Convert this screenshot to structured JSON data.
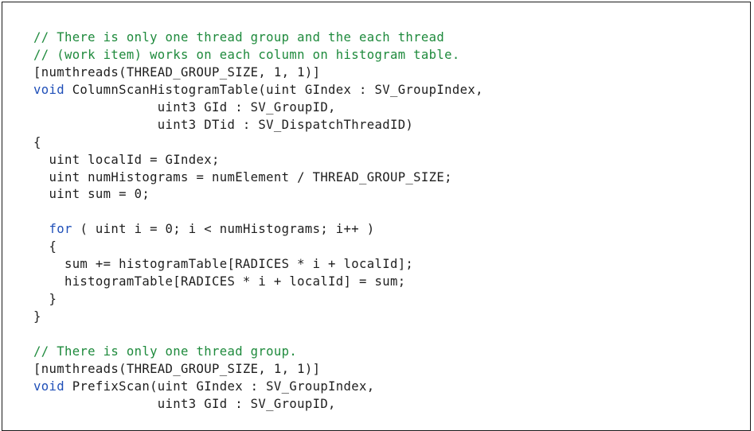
{
  "code": {
    "lines": [
      [
        {
          "t": "// There is only one thread group and the each thread",
          "k": "comment"
        }
      ],
      [
        {
          "t": "// (work item) works on each column on histogram table.",
          "k": "comment"
        }
      ],
      [
        {
          "t": "[numthreads(THREAD_GROUP_SIZE, 1, 1)]",
          "k": "plain"
        }
      ],
      [
        {
          "t": "void",
          "k": "keyword"
        },
        {
          "t": " ColumnScanHistogramTable(uint GIndex : SV_GroupIndex,",
          "k": "plain"
        }
      ],
      [
        {
          "t": "                uint3 GId : SV_GroupID,",
          "k": "plain"
        }
      ],
      [
        {
          "t": "                uint3 DTid : SV_DispatchThreadID)",
          "k": "plain"
        }
      ],
      [
        {
          "t": "{",
          "k": "plain"
        }
      ],
      [
        {
          "t": "  uint localId = GIndex;",
          "k": "plain"
        }
      ],
      [
        {
          "t": "  uint numHistograms = numElement / THREAD_GROUP_SIZE;",
          "k": "plain"
        }
      ],
      [
        {
          "t": "  uint sum = 0;",
          "k": "plain"
        }
      ],
      [
        {
          "t": "",
          "k": "plain"
        }
      ],
      [
        {
          "t": "  ",
          "k": "plain"
        },
        {
          "t": "for",
          "k": "keyword"
        },
        {
          "t": " ( uint i = 0; i < numHistograms; i++ )",
          "k": "plain"
        }
      ],
      [
        {
          "t": "  {",
          "k": "plain"
        }
      ],
      [
        {
          "t": "    sum += histogramTable[RADICES * i + localId];",
          "k": "plain"
        }
      ],
      [
        {
          "t": "    histogramTable[RADICES * i + localId] = sum;",
          "k": "plain"
        }
      ],
      [
        {
          "t": "  }",
          "k": "plain"
        }
      ],
      [
        {
          "t": "}",
          "k": "plain"
        }
      ],
      [
        {
          "t": "",
          "k": "plain"
        }
      ],
      [
        {
          "t": "// There is only one thread group.",
          "k": "comment"
        }
      ],
      [
        {
          "t": "[numthreads(THREAD_GROUP_SIZE, 1, 1)]",
          "k": "plain"
        }
      ],
      [
        {
          "t": "void",
          "k": "keyword"
        },
        {
          "t": " PrefixScan(uint GIndex : SV_GroupIndex,",
          "k": "plain"
        }
      ],
      [
        {
          "t": "                uint3 GId : SV_GroupID,",
          "k": "plain"
        }
      ]
    ]
  },
  "colors": {
    "comment": "#1e8a3c",
    "keyword": "#1f4fb8",
    "text": "#1e1e1e",
    "border": "#1a1a1a",
    "background": "#ffffff"
  }
}
